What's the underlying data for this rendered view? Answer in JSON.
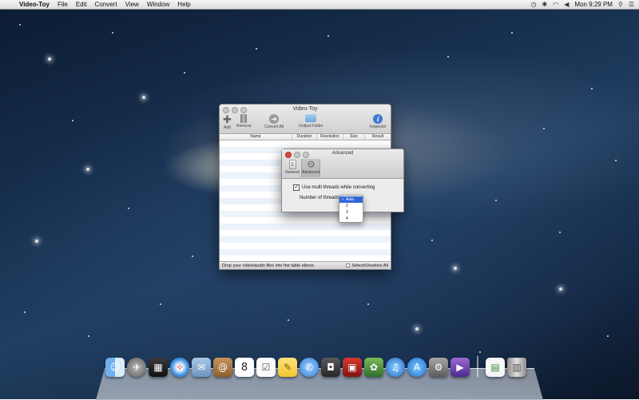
{
  "menubar": {
    "app_name": "Video-Toy",
    "menus": [
      "File",
      "Edit",
      "Convert",
      "View",
      "Window",
      "Help"
    ],
    "clock": "Mon 9:29 PM"
  },
  "main_window": {
    "title": "Video-Toy",
    "toolbar": {
      "add": "Add",
      "remove": "Remove",
      "convert_all": "Convert All",
      "output_folder": "Output Folder",
      "inspector": "Inspector"
    },
    "columns": [
      "Name",
      "Duration",
      "Resolution",
      "Size",
      "Result"
    ],
    "status_text": "Drop your video/audio files into the table above.",
    "select_all_label": "Select/Unselect All"
  },
  "advanced_panel": {
    "title": "Advanced",
    "tabs": {
      "general": "General",
      "advanced": "Advanced"
    },
    "multithread_label": "Use multi threads while converting",
    "threads_label": "Number of threads:"
  },
  "threads_dropdown": {
    "options": [
      "Auto",
      "2",
      "3",
      "4"
    ],
    "selected": "Auto"
  },
  "dock": {
    "icons": [
      "finder-icon",
      "launchpad-icon",
      "mission-control-icon",
      "safari-icon",
      "mail-icon",
      "contacts-icon",
      "calendar-icon",
      "reminders-icon",
      "notes-icon",
      "messages-icon",
      "facetime-icon",
      "photo-booth-icon",
      "iphoto-icon",
      "itunes-icon",
      "app-store-icon",
      "system-preferences-icon",
      "video-toy-icon",
      "documents-icon",
      "trash-icon"
    ],
    "calendar_day": "8"
  },
  "colors": {
    "accent": "#2f67d9",
    "close_button": "#e2483f"
  }
}
